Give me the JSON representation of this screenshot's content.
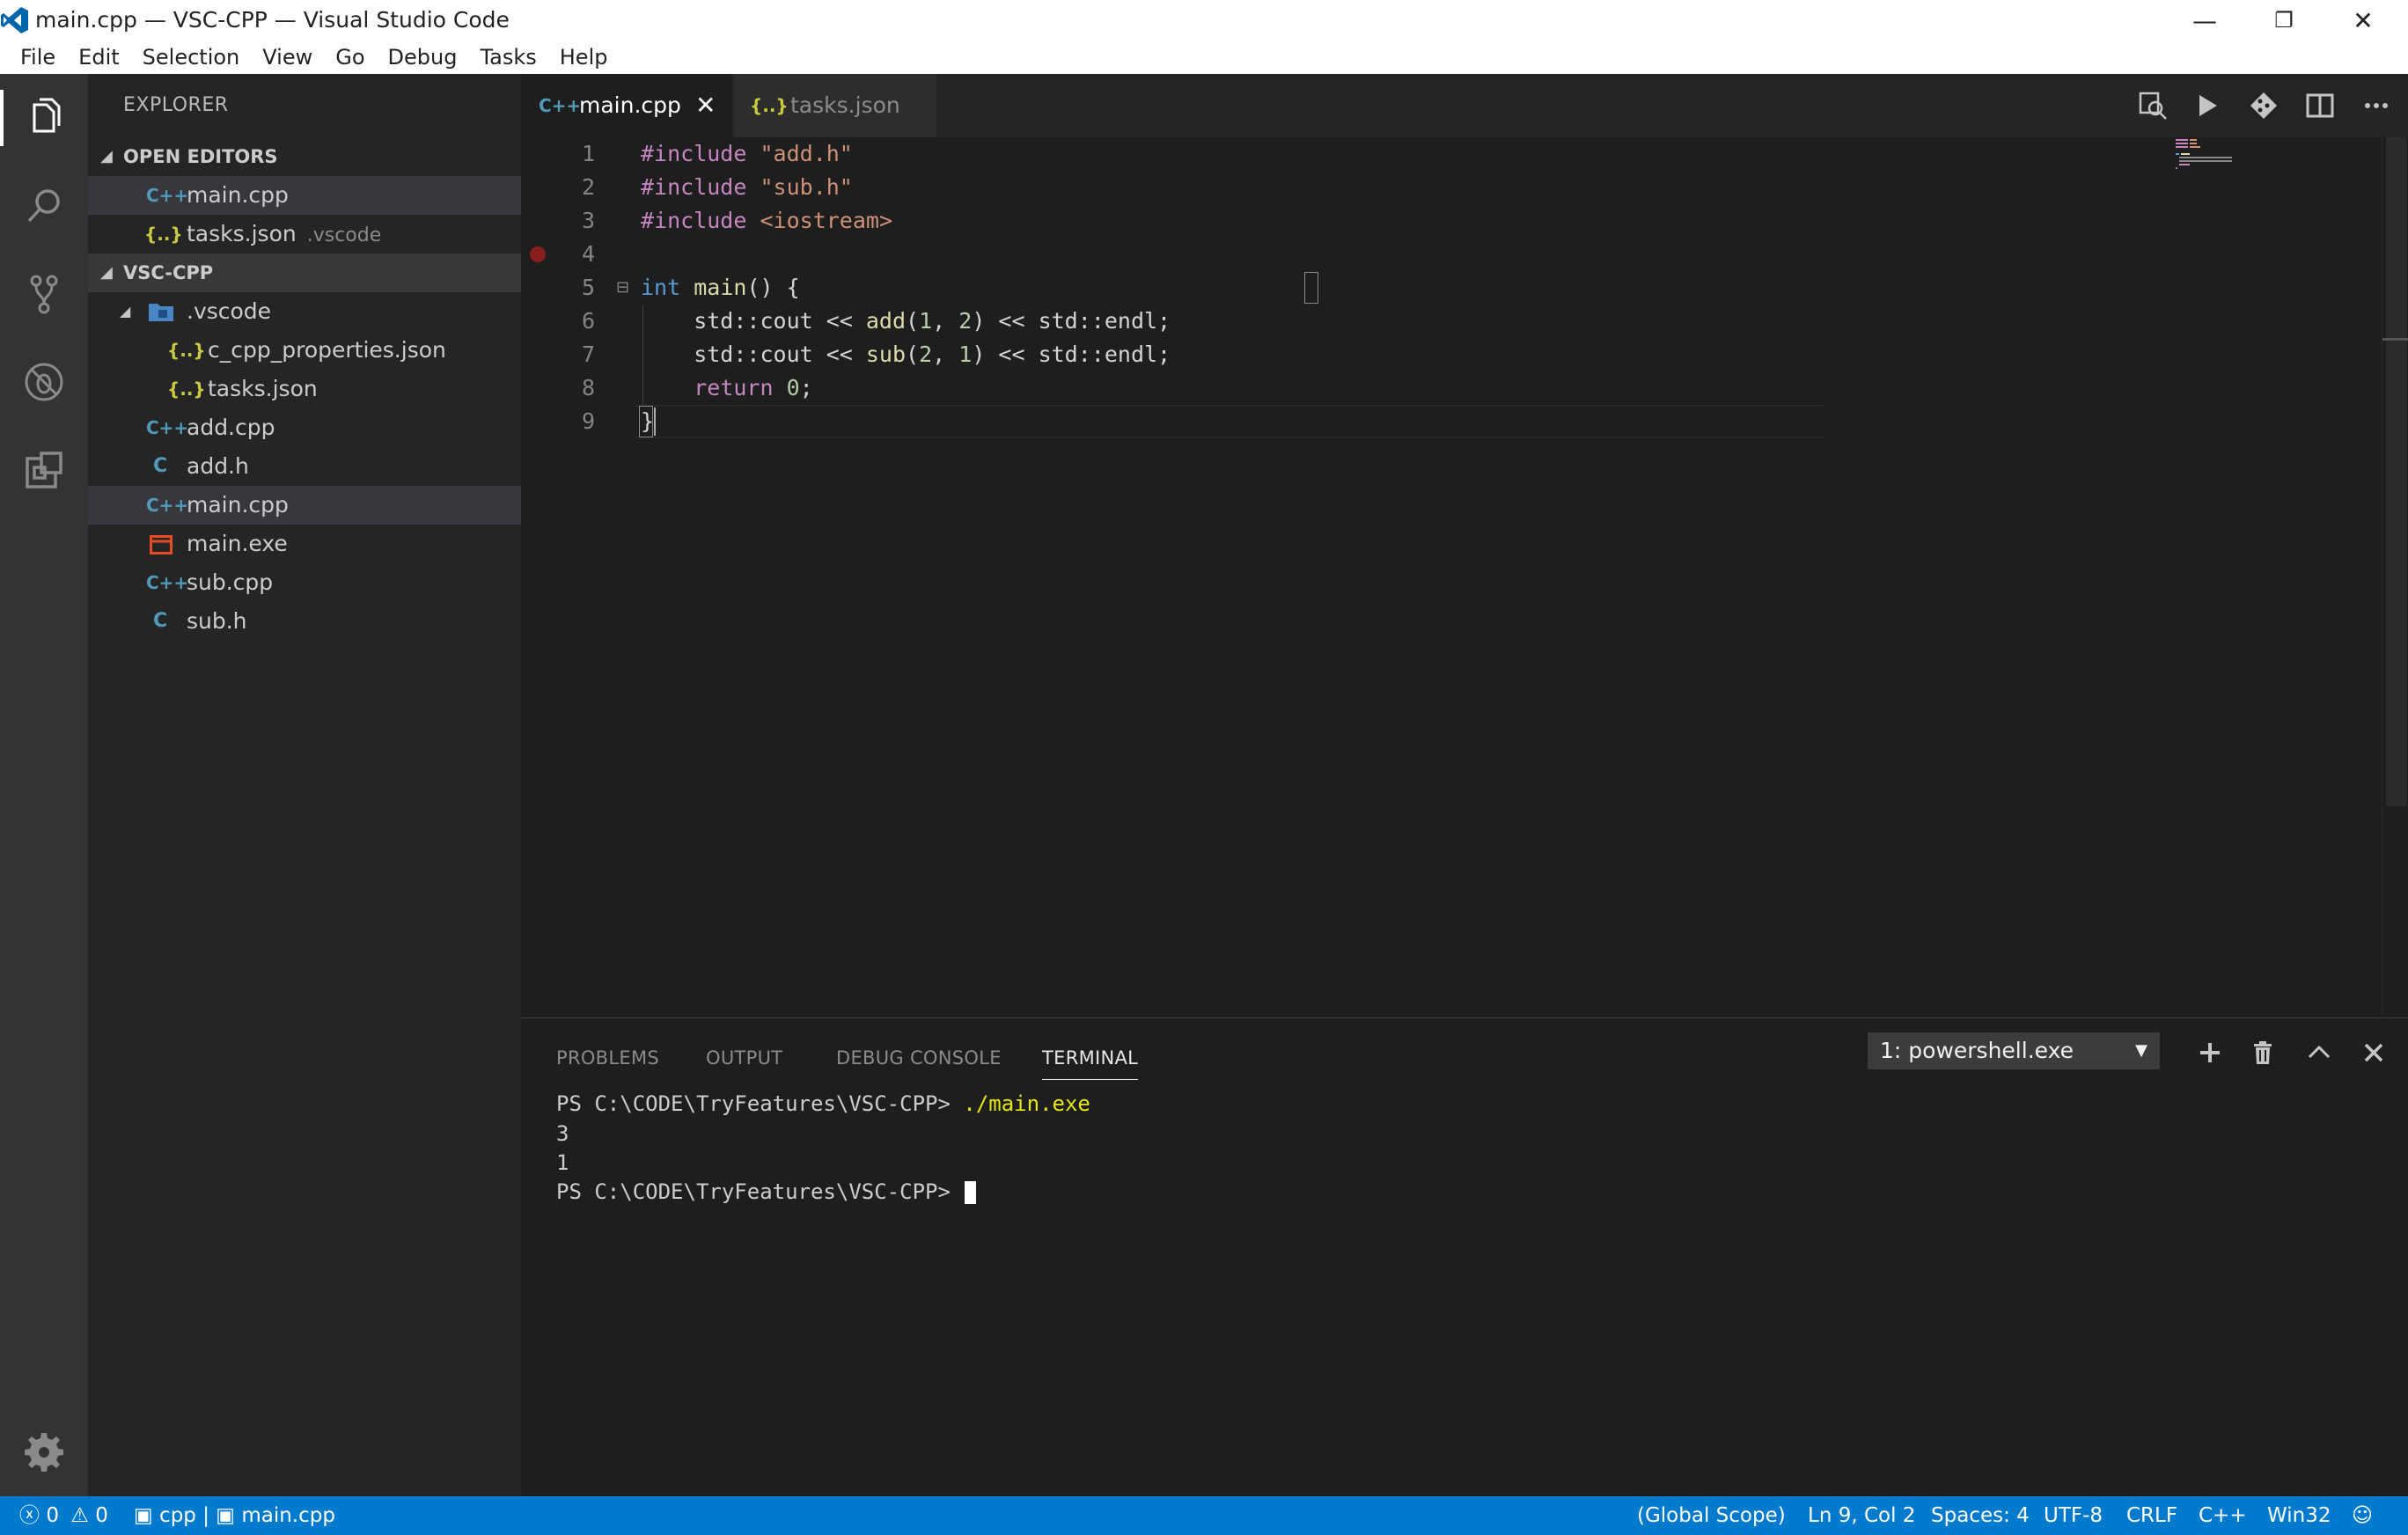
{
  "window": {
    "title": "main.cpp — VSC-CPP — Visual Studio Code",
    "minimize_glyph": "—",
    "restore_glyph": "❐",
    "close_glyph": "✕"
  },
  "menu": [
    "File",
    "Edit",
    "Selection",
    "View",
    "Go",
    "Debug",
    "Tasks",
    "Help"
  ],
  "sidebar": {
    "title": "EXPLORER",
    "open_editors_label": "OPEN EDITORS",
    "open_editors": [
      {
        "icon": "C++",
        "name": "main.cpp",
        "desc": ""
      },
      {
        "icon": "{..}",
        "name": "tasks.json",
        "desc": ".vscode"
      }
    ],
    "folder_label": "VSC-CPP",
    "tree": [
      {
        "icon": "folder",
        "name": ".vscode"
      },
      {
        "icon": "{..}",
        "name": "c_cpp_properties.json"
      },
      {
        "icon": "{..}",
        "name": "tasks.json"
      },
      {
        "icon": "C++",
        "name": "add.cpp"
      },
      {
        "icon": "C",
        "name": "add.h"
      },
      {
        "icon": "C++",
        "name": "main.cpp"
      },
      {
        "icon": "exe",
        "name": "main.exe"
      },
      {
        "icon": "C++",
        "name": "sub.cpp"
      },
      {
        "icon": "C",
        "name": "sub.h"
      }
    ]
  },
  "tabs": [
    {
      "icon": "C++",
      "label": "main.cpp",
      "close": "✕"
    },
    {
      "icon": "{..}",
      "label": "tasks.json"
    }
  ],
  "editor": {
    "line_numbers": [
      "1",
      "2",
      "3",
      "4",
      "5",
      "6",
      "7",
      "8",
      "9"
    ]
  },
  "panel": {
    "tabs": [
      "PROBLEMS",
      "OUTPUT",
      "DEBUG CONSOLE",
      "TERMINAL"
    ],
    "terminal_select": "1: powershell.exe",
    "terminal_lines": {
      "prompt1": "PS C:\\CODE\\TryFeatures\\VSC-CPP> ",
      "cmd1": "./main.exe",
      "out1": "3",
      "out2": "1",
      "prompt2": "PS C:\\CODE\\TryFeatures\\VSC-CPP> "
    }
  },
  "status": {
    "errors": "0",
    "warnings": "0",
    "project": "cpp",
    "file": "main.cpp",
    "scope": "(Global Scope)",
    "position": "Ln 9, Col 2",
    "spaces": "Spaces: 4",
    "encoding": "UTF-8",
    "eol": "CRLF",
    "language": "C++",
    "platform": "Win32"
  },
  "colors": {
    "status_bar": "#007acc",
    "activity_bar": "#333333",
    "sidebar": "#252526",
    "editor": "#1e1e1e"
  }
}
